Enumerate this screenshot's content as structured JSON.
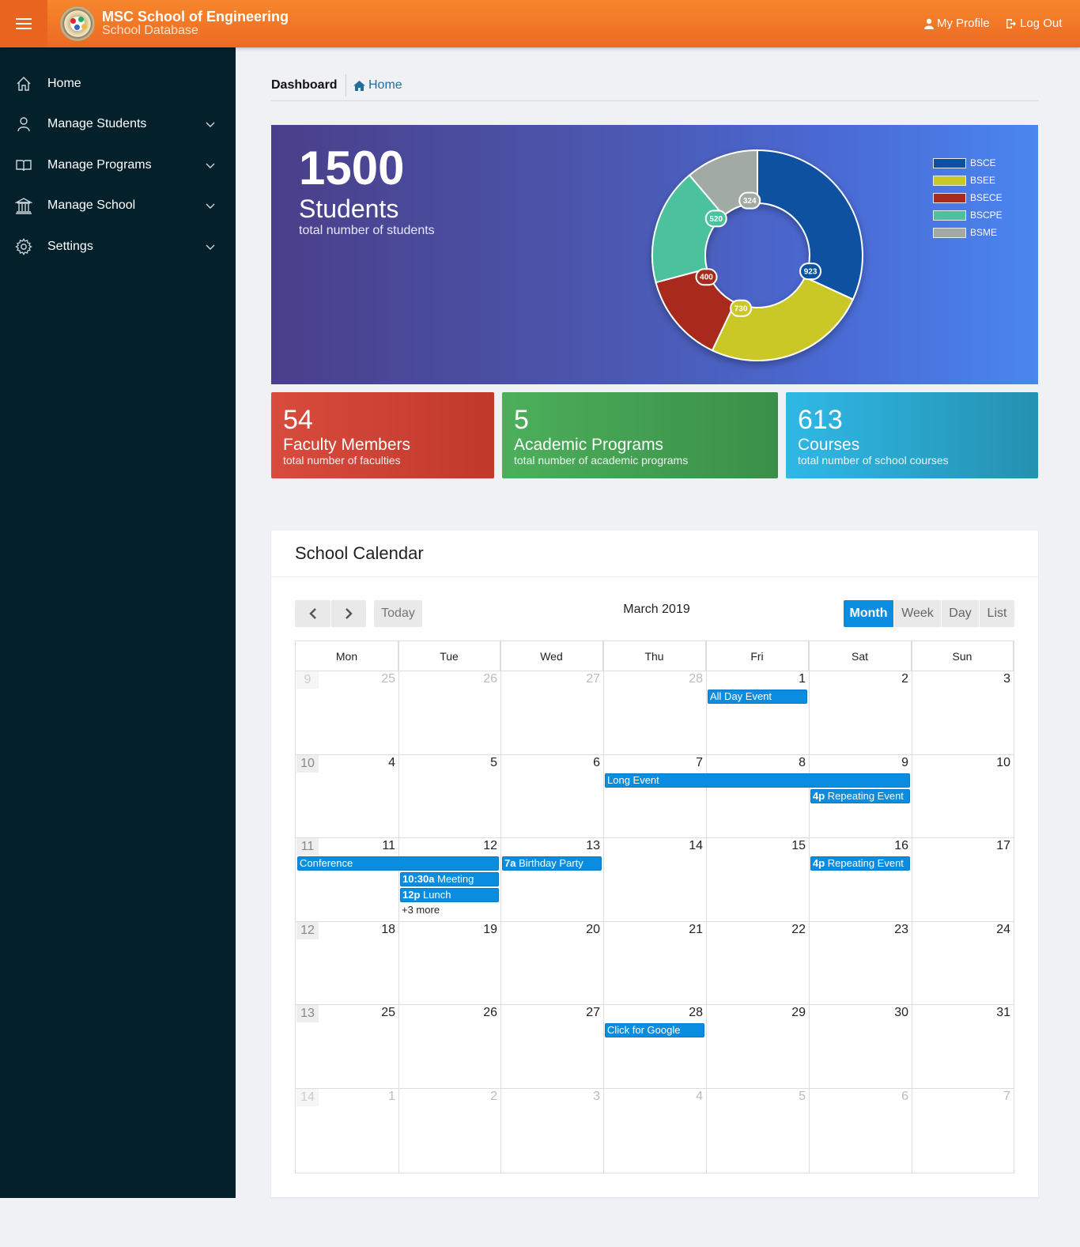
{
  "header": {
    "title": "MSC School of Engineering",
    "subtitle": "School Database",
    "profile_label": "My Profile",
    "logout_label": "Log Out"
  },
  "sidebar": {
    "items": [
      {
        "label": "Home",
        "icon": "home-icon"
      },
      {
        "label": "Manage Students",
        "icon": "user-icon"
      },
      {
        "label": "Manage Programs",
        "icon": "book-icon"
      },
      {
        "label": "Manage School",
        "icon": "building-icon"
      },
      {
        "label": "Settings",
        "icon": "gear-icon"
      }
    ]
  },
  "breadcrumb": {
    "title": "Dashboard",
    "home": "Home"
  },
  "hero": {
    "number": "1500",
    "label": "Students",
    "sublabel": "total number of students"
  },
  "chart_data": {
    "type": "pie",
    "donut": true,
    "categories": [
      "BSCE",
      "BSEE",
      "BSECE",
      "BSCPE",
      "BSME"
    ],
    "values": [
      923,
      730,
      400,
      520,
      324
    ],
    "colors": [
      "#0a51a0",
      "#c9c826",
      "#a92b1d",
      "#4cc19e",
      "#a2aaa4"
    ],
    "legend_position": "top-right"
  },
  "stats": [
    {
      "number": "54",
      "label": "Faculty Members",
      "sublabel": "total number of faculties"
    },
    {
      "number": "5",
      "label": "Academic Programs",
      "sublabel": "total number of academic programs"
    },
    {
      "number": "613",
      "label": "Courses",
      "sublabel": "total number of school courses"
    }
  ],
  "calendar": {
    "title": "School Calendar",
    "month": "March 2019",
    "today_label": "Today",
    "prev_icon": "chevron-left-icon",
    "next_icon": "chevron-right-icon",
    "views": [
      "Month",
      "Week",
      "Day",
      "List"
    ],
    "active_view": "Month",
    "days_of_week": [
      "Mon",
      "Tue",
      "Wed",
      "Thu",
      "Fri",
      "Sat",
      "Sun"
    ],
    "weeks": [
      {
        "week": "9",
        "days": [
          "25",
          "26",
          "27",
          "28",
          "1",
          "2",
          "3"
        ],
        "other": [
          true,
          true,
          true,
          true,
          false,
          false,
          false
        ],
        "week_other": true
      },
      {
        "week": "10",
        "days": [
          "4",
          "5",
          "6",
          "7",
          "8",
          "9",
          "10"
        ],
        "other": [
          false,
          false,
          false,
          false,
          false,
          false,
          false
        ],
        "week_other": false
      },
      {
        "week": "11",
        "days": [
          "11",
          "12",
          "13",
          "14",
          "15",
          "16",
          "17"
        ],
        "other": [
          false,
          false,
          false,
          false,
          false,
          false,
          false
        ],
        "week_other": false
      },
      {
        "week": "12",
        "days": [
          "18",
          "19",
          "20",
          "21",
          "22",
          "23",
          "24"
        ],
        "other": [
          false,
          false,
          false,
          false,
          false,
          false,
          false
        ],
        "week_other": false
      },
      {
        "week": "13",
        "days": [
          "25",
          "26",
          "27",
          "28",
          "29",
          "30",
          "31"
        ],
        "other": [
          false,
          false,
          false,
          false,
          false,
          false,
          false
        ],
        "week_other": false
      },
      {
        "week": "14",
        "days": [
          "1",
          "2",
          "3",
          "4",
          "5",
          "6",
          "7"
        ],
        "other": [
          true,
          true,
          true,
          true,
          true,
          true,
          true
        ],
        "week_other": true
      }
    ],
    "events": [
      {
        "week": 0,
        "start": 4,
        "span": 1,
        "slot": 0,
        "time": "",
        "title": "All Day Event"
      },
      {
        "week": 1,
        "start": 3,
        "span": 3,
        "slot": 0,
        "time": "",
        "title": "Long Event"
      },
      {
        "week": 1,
        "start": 5,
        "span": 1,
        "slot": 1,
        "time": "4p",
        "title": "Repeating Event"
      },
      {
        "week": 2,
        "start": 0,
        "span": 2,
        "slot": 0,
        "time": "",
        "title": "Conference"
      },
      {
        "week": 2,
        "start": 2,
        "span": 1,
        "slot": 0,
        "time": "7a",
        "title": "Birthday Party"
      },
      {
        "week": 2,
        "start": 1,
        "span": 1,
        "slot": 1,
        "time": "10:30a",
        "title": "Meeting"
      },
      {
        "week": 2,
        "start": 1,
        "span": 1,
        "slot": 2,
        "time": "12p",
        "title": "Lunch"
      },
      {
        "week": 2,
        "start": 5,
        "span": 1,
        "slot": 0,
        "time": "4p",
        "title": "Repeating Event"
      },
      {
        "week": 4,
        "start": 3,
        "span": 1,
        "slot": 0,
        "time": "",
        "title": "Click for Google"
      }
    ],
    "more": {
      "week": 2,
      "col": 1,
      "slot": 3,
      "label": "+3 more"
    }
  }
}
